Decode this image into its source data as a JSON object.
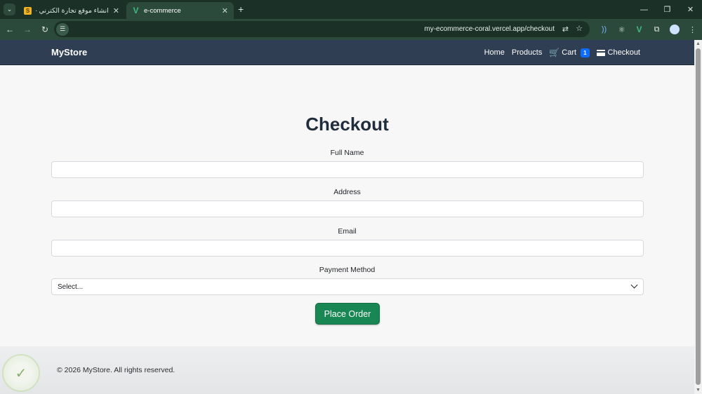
{
  "browser": {
    "tabs": [
      {
        "title": "انشاء موقع تجارة الكترني - حمسا",
        "favicon": "S",
        "active": false
      },
      {
        "title": "e-commerce",
        "favicon": "V",
        "active": true
      }
    ],
    "new_tab": "+",
    "url": "my-ecommerce-coral.vercel.app/checkout"
  },
  "navbar": {
    "brand": "MyStore",
    "links": {
      "home": "Home",
      "products": "Products",
      "cart": "Cart",
      "cart_count": "1",
      "checkout": "Checkout"
    }
  },
  "checkout": {
    "title": "Checkout",
    "full_name_label": "Full Name",
    "full_name_value": "",
    "address_label": "Address",
    "address_value": "",
    "email_label": "Email",
    "email_value": "",
    "payment_label": "Payment Method",
    "payment_selected": "Select...",
    "submit_label": "Place Order"
  },
  "footer": {
    "text": "© 2026 MyStore. All rights reserved."
  },
  "colors": {
    "navbar_bg": "#2f3e52",
    "button_success": "#198754",
    "badge_primary": "#0d6efd",
    "browser_frame": "#1b3127"
  }
}
